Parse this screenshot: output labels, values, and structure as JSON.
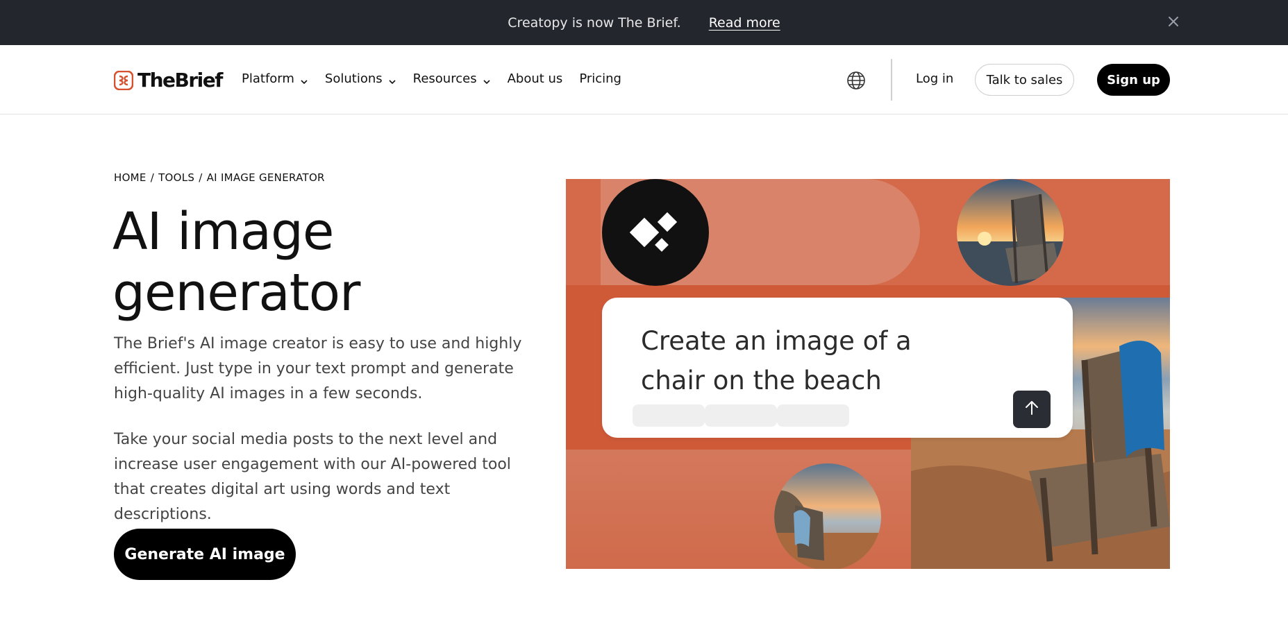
{
  "announcement": {
    "text": "Creatopy is now The Brief.",
    "link": "Read more"
  },
  "header": {
    "brand": "TheBrief",
    "nav": [
      {
        "label": "Platform",
        "dropdown": true
      },
      {
        "label": "Solutions",
        "dropdown": true
      },
      {
        "label": "Resources",
        "dropdown": true
      },
      {
        "label": "About us",
        "dropdown": false
      },
      {
        "label": "Pricing",
        "dropdown": false
      }
    ],
    "login": "Log in",
    "talk_to_sales": "Talk to sales",
    "signup": "Sign up"
  },
  "breadcrumb": [
    "HOME",
    "TOOLS",
    "AI IMAGE GENERATOR"
  ],
  "hero": {
    "title": "AI image generator",
    "paragraph1": "The Brief's AI image creator is easy to use and highly efficient. Just type in your text prompt and generate high-quality AI images in a few seconds.",
    "paragraph2": "Take your social media posts to the next level and increase user engagement with our AI-powered tool that creates digital art using words and text descriptions.",
    "cta": "Generate AI image"
  },
  "illustration": {
    "prompt": "Create an image of a chair on the beach"
  },
  "colors": {
    "announce_bg": "#23262d",
    "brand_accent": "#d6522e",
    "art_bg": "#cf5a38",
    "primary_button": "#000000"
  },
  "icons": {
    "close": "close-icon",
    "chevron": "chevron-down-icon",
    "globe": "globe-icon",
    "send": "arrow-up-icon",
    "logo": "brief-logo-icon"
  }
}
